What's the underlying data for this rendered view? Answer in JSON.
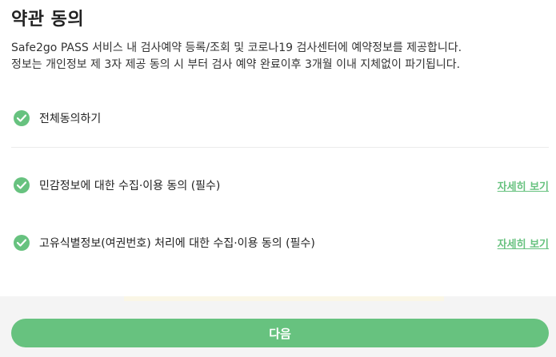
{
  "header": {
    "title": "약관 동의"
  },
  "description": {
    "line1": "Safe2go PASS 서비스 내 검사예약 등록/조회 및 코로나19 검사센터에 예약정보를 제공합니다.",
    "line2": "정보는 개인정보 제 3자 제공 동의 시 부터 검사 예약 완료이후 3개월 이내 지체없이 파기됩니다."
  },
  "agreements": {
    "all": {
      "label": "전체동의하기",
      "checked": true
    },
    "items": [
      {
        "label": "민감정보에 대한 수집·이용 동의 (필수)",
        "detail_label": "자세히 보기",
        "checked": true
      },
      {
        "label": "고유식별정보(여권번호) 처리에 대한 수집·이용 동의 (필수)",
        "detail_label": "자세히 보기",
        "checked": true
      }
    ]
  },
  "footer": {
    "next_label": "다음"
  },
  "colors": {
    "accent": "#67c27f",
    "divider": "#ececec",
    "footer_bg": "#f4f4f4"
  },
  "icons": {
    "check": "check-circle-icon"
  }
}
